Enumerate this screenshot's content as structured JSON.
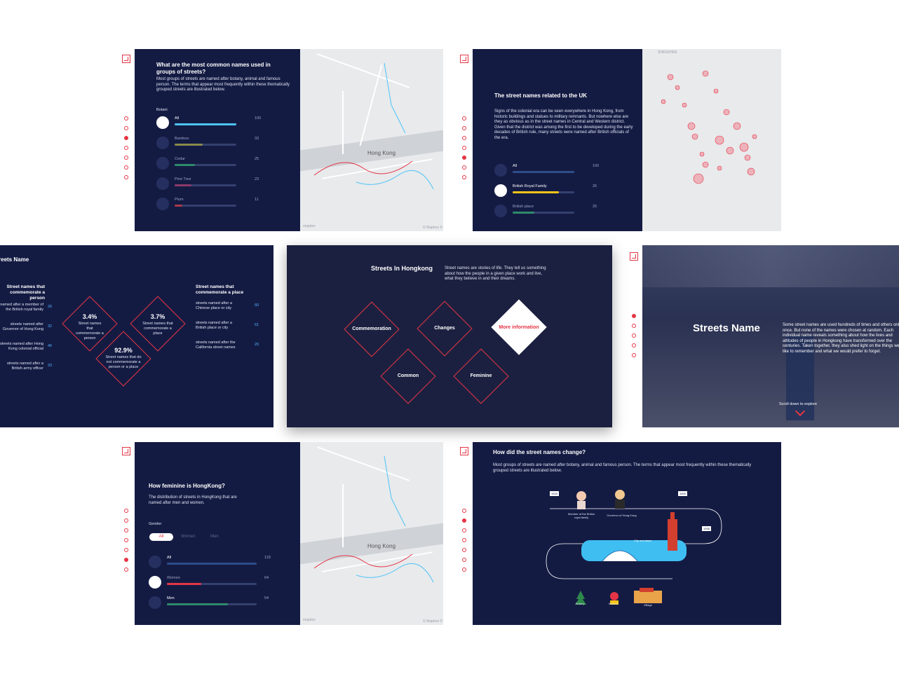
{
  "colors": {
    "navy": "#141b43",
    "accent": "#e53545",
    "cyan": "#4fc3f7",
    "white": "#ffffff"
  },
  "slide1": {
    "title": "What are the most common names used in groups of streets?",
    "body": "Most groups of streets are named after botany, animal and famous person. The terms that appear most frequently within these thematically grouped streets are illustrated below.",
    "category": "Botani",
    "rows": [
      {
        "label": "All",
        "value": "100",
        "fill": 1.0,
        "color": "#4fc3f7"
      },
      {
        "label": "Bamboo",
        "value": "33",
        "fill": 0.45,
        "color": "#8a8a4a"
      },
      {
        "label": "Cedar",
        "value": "25",
        "fill": 0.33,
        "color": "#2e8a6a"
      },
      {
        "label": "Pine Tree",
        "value": "23",
        "fill": 0.27,
        "color": "#8a3a6a"
      },
      {
        "label": "Plum",
        "value": "11",
        "fill": 0.12,
        "color": "#a83a4a"
      }
    ],
    "map_labels": {
      "city": "Hong Kong",
      "credit": "© Mapbox ©",
      "logo": "mapbox"
    }
  },
  "slide2": {
    "title": "The street names related to the UK",
    "body": "Signs of the colonial era can be seen everywhere in Hong Kong, from historic buildings and statues to military remnants. But nowhere else are they as obvious as in the street names in Central and Western district. Given that the district was among the first to be developed during the early decades of British rule, many streets were named after British officials of the era.",
    "rows": [
      {
        "label": "All",
        "value": "100",
        "fill": 1.0,
        "color": "#2e4d8a"
      },
      {
        "label": "British Royal Family",
        "value": "26",
        "fill": 0.75,
        "color": "#f5c518"
      },
      {
        "label": "British place",
        "value": "25",
        "fill": 0.35,
        "color": "#2e8a6a"
      }
    ],
    "map_label": "SHENZHEN"
  },
  "slide3": {
    "title": "Streets Name",
    "left_heading": "Street names that commemorate a person",
    "left_items": [
      {
        "text": "named after a member of the British royal family",
        "value": "26"
      },
      {
        "text": "streets named after Governor of Hong Kong",
        "value": "32"
      },
      {
        "text": "streets named after Hong Kong colonial official",
        "value": "46"
      },
      {
        "text": "streets named after a British army officer",
        "value": "33"
      }
    ],
    "d1": {
      "pct": "3.4%",
      "text": "Street names that commemorate a person"
    },
    "d2": {
      "pct": "3.7%",
      "text": "Street names that commemorate a place"
    },
    "d3": {
      "pct": "92.9%",
      "text": "Street names that do not commemorate a person or a place"
    },
    "right_heading": "Street names that commemorate a place",
    "right_items": [
      {
        "text": "streets named after a Chinese place or city",
        "value": "60"
      },
      {
        "text": "streets named after a British place or city",
        "value": "61"
      },
      {
        "text": "streets named after the California street names",
        "value": "20"
      }
    ]
  },
  "slide4": {
    "title": "Streets In Hongkong",
    "body": "Street names are stories of life. They tell us something about how the people in a given place work and live, what they believe in and their dreams.",
    "buttons": [
      "Commemoration",
      "Changes",
      "More information",
      "Common",
      "Feminine"
    ]
  },
  "slide5": {
    "title": "Streets Name",
    "body": "Some street names are used hundreds of times and others only once. But none of the names were chosen at random. Each individual name reveals something about how the lives and attitudes of people in Hongkong have transformed over the centuries. Taken together, they also shed light on the things we like to remember and what we would prefer to forget.",
    "scroll": "Scroll down to explore"
  },
  "slide6": {
    "title": "How feminine is HongKong?",
    "body": "The distribution of streets in HongKong that are named after men and women.",
    "gender_label": "Gender",
    "tabs": [
      "All",
      "Women",
      "Men"
    ],
    "rows": [
      {
        "label": "All",
        "value": "118",
        "fill": 1.0,
        "color": "#2e4d8a"
      },
      {
        "label": "Women",
        "value": "64",
        "fill": 0.38,
        "color": "#e53545"
      },
      {
        "label": "Men",
        "value": "54",
        "fill": 0.68,
        "color": "#2e8a6a"
      }
    ],
    "map_labels": {
      "city": "Hong Kong",
      "credit": "© Mapbox ©",
      "logo": "mapbox"
    }
  },
  "slide7": {
    "title": "How did the street names change?",
    "body": "Most groups of streets are named after botany, animal and famous person. The terms that appear most frequently within these thematically grouped streets are illustrated below.",
    "flags": [
      "1918",
      "1900",
      "1945"
    ],
    "labels": [
      "Member of the British royal family",
      "Governor of Hong Kong",
      "City and place",
      "Botany",
      "Mascot",
      "Village"
    ]
  }
}
